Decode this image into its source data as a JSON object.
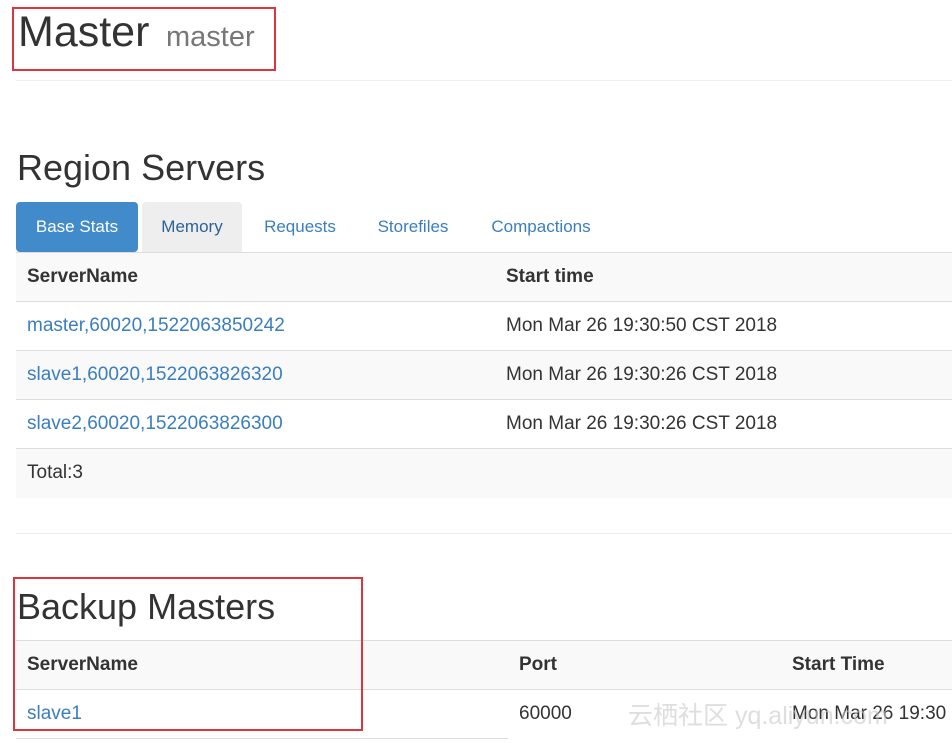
{
  "header": {
    "title": "Master",
    "subtitle": "master"
  },
  "region_servers": {
    "title": "Region Servers",
    "tabs": [
      {
        "label": "Base Stats",
        "state": "active"
      },
      {
        "label": "Memory",
        "state": "hover"
      },
      {
        "label": "Requests",
        "state": "normal"
      },
      {
        "label": "Storefiles",
        "state": "normal"
      },
      {
        "label": "Compactions",
        "state": "normal"
      }
    ],
    "columns": [
      "ServerName",
      "Start time"
    ],
    "rows": [
      {
        "server": "master,60020,1522063850242",
        "start": "Mon Mar 26 19:30:50 CST 2018"
      },
      {
        "server": "slave1,60020,1522063826320",
        "start": "Mon Mar 26 19:30:26 CST 2018"
      },
      {
        "server": "slave2,60020,1522063826300",
        "start": "Mon Mar 26 19:30:26 CST 2018"
      }
    ],
    "total": "Total:3"
  },
  "backup_masters": {
    "title": "Backup Masters",
    "columns": [
      "ServerName",
      "Port",
      "Start Time"
    ],
    "rows": [
      {
        "server": "slave1",
        "port": "60000",
        "start": "Mon Mar 26 19:30"
      }
    ]
  },
  "watermark": "云栖社区 yq.aliyun.com",
  "colors": {
    "link": "#3a7ebf",
    "active_tab": "#428bca",
    "highlight_box": "#d9363e"
  }
}
